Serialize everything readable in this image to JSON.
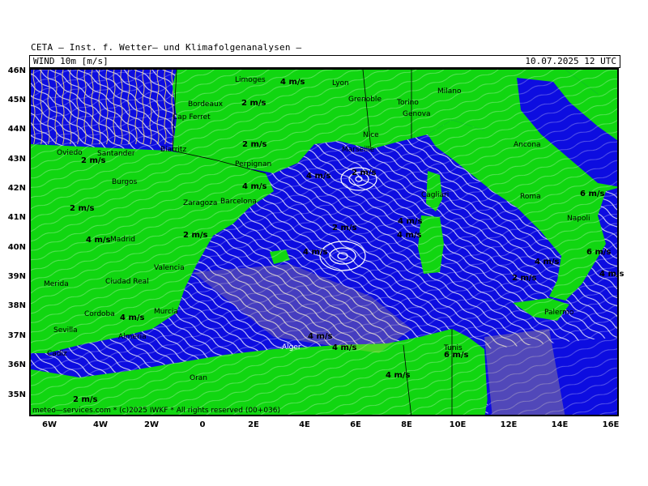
{
  "header": {
    "org": "CETA — Inst. f. Wetter— und Klimafolgenanalysen —",
    "field": "WIND  10m  [m/s]",
    "datetime": "10.07.2025  12  UTC"
  },
  "axes": {
    "lat_labels": [
      "46N",
      "45N",
      "44N",
      "43N",
      "42N",
      "41N",
      "40N",
      "39N",
      "38N",
      "37N",
      "36N",
      "35N"
    ],
    "lon_labels": [
      "6W",
      "4W",
      "2W",
      "0",
      "2E",
      "4E",
      "6E",
      "8E",
      "10E",
      "12E",
      "14E",
      "16E"
    ]
  },
  "cities": [
    {
      "name": "Limoges",
      "sea": false
    },
    {
      "name": "Lyon",
      "sea": false
    },
    {
      "name": "Milano",
      "sea": false
    },
    {
      "name": "Bordeaux",
      "sea": false
    },
    {
      "name": "Torino",
      "sea": false
    },
    {
      "name": "Grenoble",
      "sea": false
    },
    {
      "name": "Cap Ferret",
      "sea": false
    },
    {
      "name": "Genova",
      "sea": false
    },
    {
      "name": "Oviedo",
      "sea": false
    },
    {
      "name": "Santander",
      "sea": false
    },
    {
      "name": "Biarritz",
      "sea": false
    },
    {
      "name": "Marseille",
      "sea": false
    },
    {
      "name": "Nice",
      "sea": false
    },
    {
      "name": "Ancona",
      "sea": false
    },
    {
      "name": "Perpignan",
      "sea": false
    },
    {
      "name": "Burgos",
      "sea": false
    },
    {
      "name": "Zaragoza",
      "sea": false
    },
    {
      "name": "Barcelona",
      "sea": false
    },
    {
      "name": "Roma",
      "sea": false
    },
    {
      "name": "Napoli",
      "sea": false
    },
    {
      "name": "Madrid",
      "sea": false
    },
    {
      "name": "Valencia",
      "sea": false
    },
    {
      "name": "Merida",
      "sea": false
    },
    {
      "name": "Ciudad Real",
      "sea": false
    },
    {
      "name": "Cordoba",
      "sea": false
    },
    {
      "name": "Murcia",
      "sea": false
    },
    {
      "name": "Sevilla",
      "sea": false
    },
    {
      "name": "Almeria",
      "sea": false
    },
    {
      "name": "Cadiz",
      "sea": false
    },
    {
      "name": "Oran",
      "sea": false
    },
    {
      "name": "Alger",
      "sea": true
    },
    {
      "name": "Tunis",
      "sea": false
    },
    {
      "name": "Palermo",
      "sea": false
    },
    {
      "name": "Cagliari",
      "sea": false
    }
  ],
  "speed_labels": [
    "4 m/s",
    "2 m/s",
    "2 m/s",
    "2 m/s",
    "2 m/s",
    "2 m/s",
    "4 m/s",
    "4 m/s",
    "4 m/s",
    "2 m/s",
    "4 m/s",
    "2 m/s",
    "4 m/s",
    "6 m/s",
    "4 m/s",
    "6 m/s",
    "4 m/s",
    "2 m/s",
    "4 m/s",
    "4 m/s",
    "6 m/s",
    "4 m/s",
    "4 m/s",
    "4 m/s",
    "2 m/s"
  ],
  "footer": "meteo—services.com  *  (c)2025 IWKF  *  All rights reserved  (00+036)",
  "colors": {
    "sea": "#0d0de0",
    "land": "#11d611",
    "calm_land": "#2ec82e",
    "strong_land": "#e6d84a",
    "streamline": "#ffffff",
    "strong_streamline": "#f0d060"
  }
}
